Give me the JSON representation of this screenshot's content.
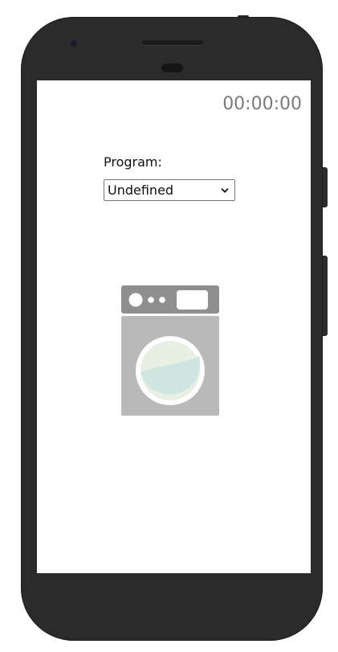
{
  "timer": {
    "display": "00:00:00"
  },
  "program": {
    "label": "Program:",
    "selected": "Undefined",
    "options": [
      "Undefined"
    ]
  },
  "icons": {
    "dropdown": "chevron-down-icon",
    "appliance": "washing-machine-icon"
  },
  "colors": {
    "phone_frame": "#2b2b2b",
    "screen": "#ffffff",
    "timer_text": "#7a7a7a",
    "washer_body": "#b9b9b9",
    "washer_panel": "#8f8f8f",
    "drum_water": "#cfe6e0",
    "drum_air": "#e8f0e4"
  }
}
